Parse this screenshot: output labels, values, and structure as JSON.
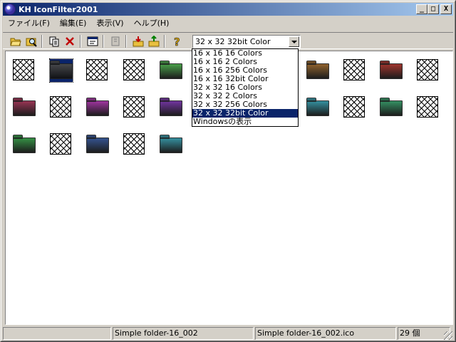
{
  "window": {
    "title": "KH IconFilter2001",
    "minimize": "_",
    "maximize": "□",
    "close": "X"
  },
  "menu": [
    "ファイル(F)",
    "編集(E)",
    "表示(V)",
    "ヘルプ(H)"
  ],
  "toolbar": {
    "format_select": "32 x 32 32bit Color"
  },
  "dropdown": {
    "options": [
      "16 x 16 16 Colors",
      "16 x 16 2 Colors",
      "16 x 16 256 Colors",
      "16 x 16 32bit Color",
      "32 x 32 16 Colors",
      "32 x 32 2 Colors",
      "32 x 32 256 Colors",
      "32 x 32 32bit Color",
      "Windowsの表示"
    ],
    "selected_index": 7
  },
  "icons": [
    {
      "kind": "empty"
    },
    {
      "kind": "folder",
      "color": "#4a4a4a"
    },
    {
      "kind": "empty"
    },
    {
      "kind": "empty"
    },
    {
      "kind": "folder",
      "color": "#3f9a3f"
    },
    {
      "kind": "empty"
    },
    {
      "kind": "empty"
    },
    {
      "kind": "empty"
    },
    {
      "kind": "folder",
      "color": "#8a5a22"
    },
    {
      "kind": "empty"
    },
    {
      "kind": "folder",
      "color": "#9a2a22"
    },
    {
      "kind": "empty"
    },
    {
      "kind": "folder",
      "color": "#922a4a"
    },
    {
      "kind": "empty"
    },
    {
      "kind": "folder",
      "color": "#9a2a9a"
    },
    {
      "kind": "empty"
    },
    {
      "kind": "folder",
      "color": "#6a2a9a"
    },
    {
      "kind": "empty"
    },
    {
      "kind": "empty"
    },
    {
      "kind": "empty"
    },
    {
      "kind": "folder",
      "color": "#2a8a9a"
    },
    {
      "kind": "empty"
    },
    {
      "kind": "folder",
      "color": "#2a8a5a"
    },
    {
      "kind": "empty"
    },
    {
      "kind": "folder",
      "color": "#2a8a3a"
    },
    {
      "kind": "empty"
    },
    {
      "kind": "folder",
      "color": "#2a4a8a"
    },
    {
      "kind": "empty"
    },
    {
      "kind": "folder",
      "color": "#2a8a9a"
    }
  ],
  "status": {
    "pane1": "",
    "pane2": "Simple folder-16_002",
    "pane3": "Simple folder-16_002.ico",
    "pane4": "29 個"
  }
}
